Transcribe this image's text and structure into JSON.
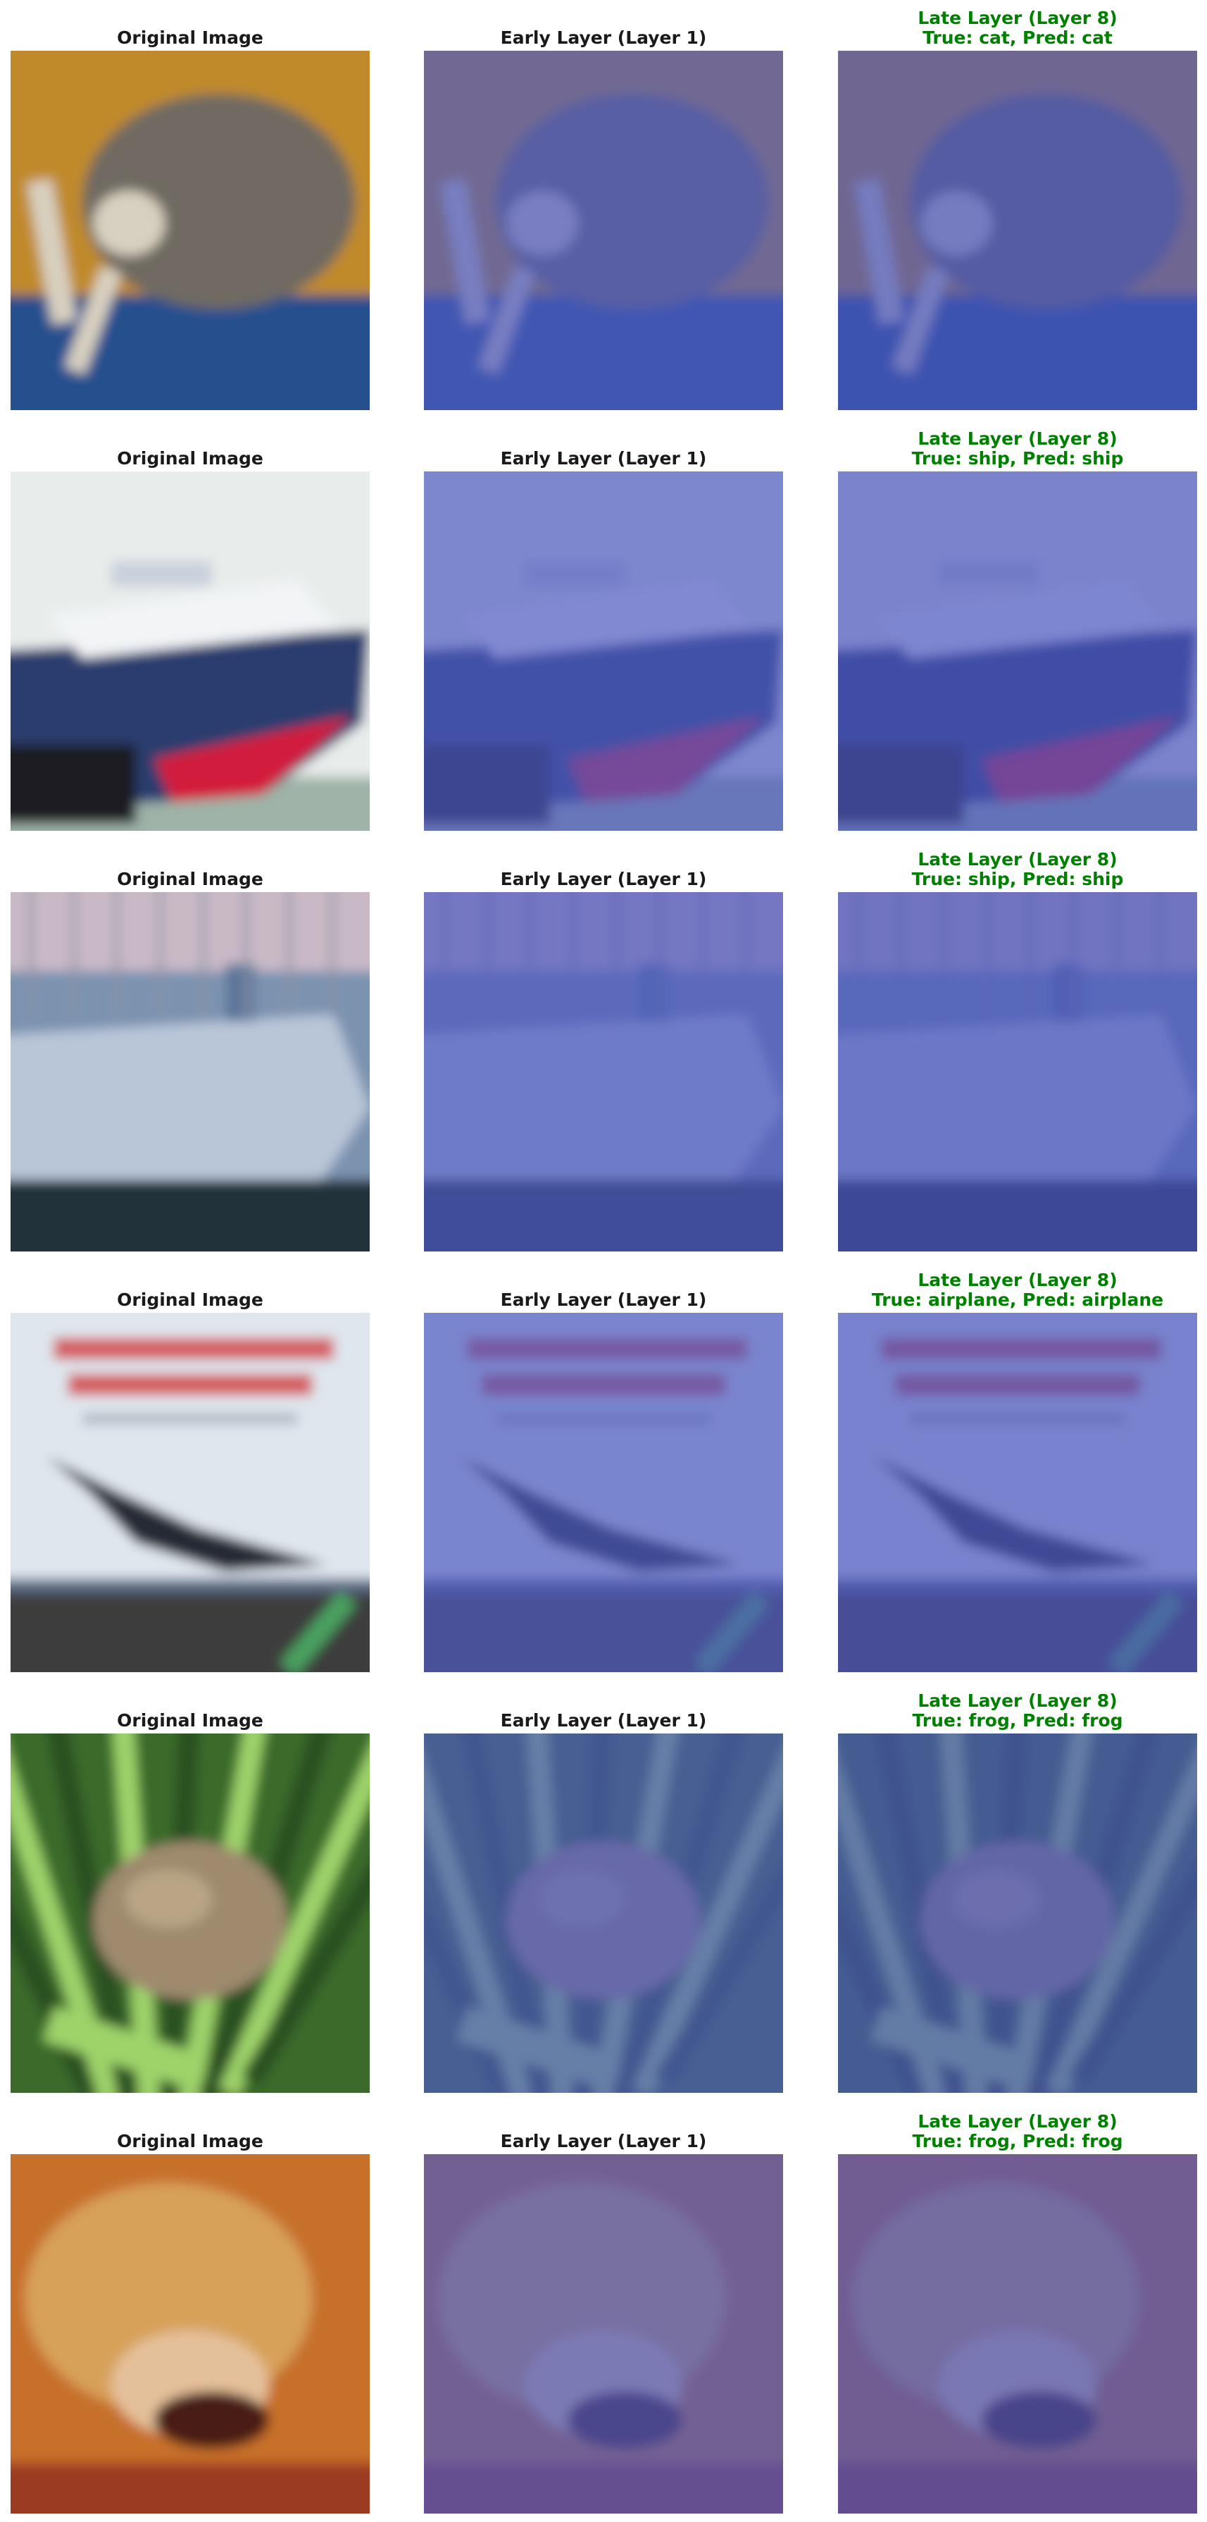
{
  "rows": [
    {
      "original_title": "Original Image",
      "early_title": "Early Layer (Layer 1)",
      "late_title_line1": "Late Layer (Layer 8)",
      "late_title_line2": "True: cat, Pred: cat",
      "true_label": "cat",
      "pred_label": "cat",
      "colors": {
        "bg": "#c08a2a",
        "fg": "#6f6a62",
        "low": "#254f8e",
        "accent": "#d8d0c0"
      }
    },
    {
      "original_title": "Original Image",
      "early_title": "Early Layer (Layer 1)",
      "late_title_line1": "Late Layer (Layer 8)",
      "late_title_line2": "True: ship, Pred: ship",
      "true_label": "ship",
      "pred_label": "ship",
      "colors": {
        "bg": "#e8ecea",
        "fg": "#2b3c6e",
        "low": "#1c1c24",
        "accent": "#d21f3c"
      }
    },
    {
      "original_title": "Original Image",
      "early_title": "Early Layer (Layer 1)",
      "late_title_line1": "Late Layer (Layer 8)",
      "late_title_line2": "True: ship, Pred: ship",
      "true_label": "ship",
      "pred_label": "ship",
      "colors": {
        "bg": "#d6c9cf",
        "fg": "#5a7599",
        "low": "#23303a",
        "accent": "#b9c6d8"
      }
    },
    {
      "original_title": "Original Image",
      "early_title": "Early Layer (Layer 1)",
      "late_title_line1": "Late Layer (Layer 8)",
      "late_title_line2": "True: airplane, Pred: airplane",
      "true_label": "airplane",
      "pred_label": "airplane",
      "colors": {
        "bg": "#dfe6ee",
        "fg": "#262a34",
        "low": "#3c3c3c",
        "accent": "#d13a3a"
      }
    },
    {
      "original_title": "Original Image",
      "early_title": "Early Layer (Layer 1)",
      "late_title_line1": "Late Layer (Layer 8)",
      "late_title_line2": "True: frog, Pred: frog",
      "true_label": "frog",
      "pred_label": "frog",
      "colors": {
        "bg": "#3a6b2c",
        "fg": "#9f8a6e",
        "low": "#111a10",
        "accent": "#9ed36a"
      }
    },
    {
      "original_title": "Original Image",
      "early_title": "Early Layer (Layer 1)",
      "late_title_line1": "Late Layer (Layer 8)",
      "late_title_line2": "True: frog, Pred: frog",
      "true_label": "frog",
      "pred_label": "frog",
      "colors": {
        "bg": "#c7702b",
        "fg": "#d7a15a",
        "low": "#4a1c12",
        "accent": "#e4c09a"
      }
    }
  ],
  "tints": {
    "early": "#4f5bc2",
    "late": "#4a56c0"
  }
}
